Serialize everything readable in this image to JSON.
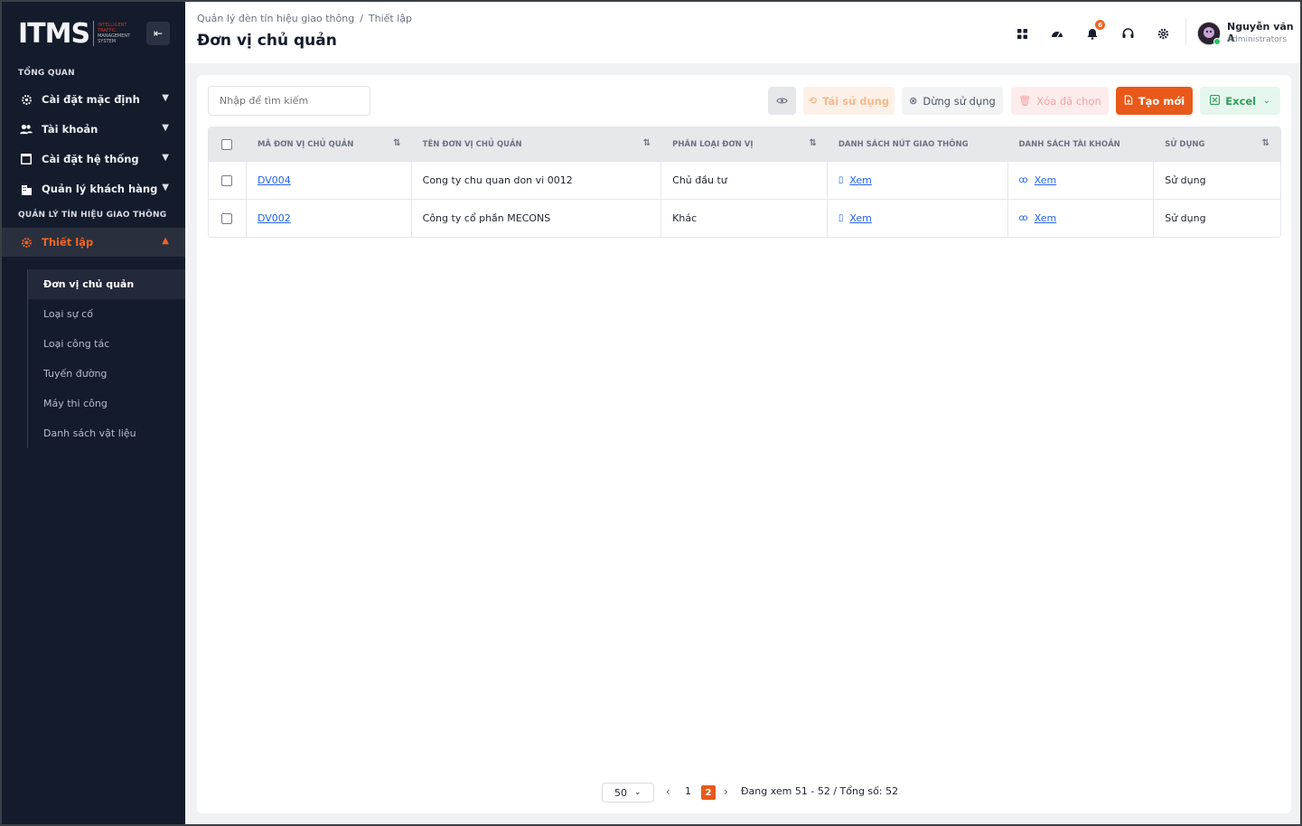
{
  "app": {
    "logo_text": "ITMS",
    "logo_sub": [
      "INTELLIGENT",
      "TRAFFIC",
      "MANAGEMENT",
      "SYSTEM"
    ]
  },
  "sidebar": {
    "section_overview": "TỔNG QUAN",
    "items": [
      {
        "label": "Cài đặt mặc định",
        "icon": "gear-icon"
      },
      {
        "label": "Tài khoản",
        "icon": "users-icon"
      },
      {
        "label": "Cài đặt hệ thống",
        "icon": "window-icon"
      },
      {
        "label": "Quản lý khách hàng",
        "icon": "building-icon"
      }
    ],
    "section_traffic": "QUẢN LÝ TÍN HIỆU GIAO THÔNG",
    "active_item": {
      "label": "Thiết lập",
      "icon": "gear-icon"
    },
    "subitems": [
      {
        "label": "Đơn vị chủ quản",
        "active": true
      },
      {
        "label": "Loại sự cố",
        "active": false
      },
      {
        "label": "Loại công tác",
        "active": false
      },
      {
        "label": "Tuyến đường",
        "active": false
      },
      {
        "label": "Máy thi công",
        "active": false
      },
      {
        "label": "Danh sách vật liệu",
        "active": false
      }
    ]
  },
  "header": {
    "breadcrumb": [
      "Quản lý đèn tín hiệu giao thông",
      "Thiết lập"
    ],
    "breadcrumb_sep": "/",
    "title": "Đơn vị chủ quản",
    "notification_count": "6",
    "user": {
      "name": "Nguyễn văn A",
      "role": "Administrators"
    }
  },
  "toolbar": {
    "search_placeholder": "Nhập để tìm kiếm",
    "reuse_label": "Tái sử dụng",
    "stop_label": "Dừng sử dụng",
    "delete_label": "Xóa đã chọn",
    "create_label": "Tạo mới",
    "excel_label": "Excel"
  },
  "table": {
    "columns": [
      "MÃ ĐƠN VỊ CHỦ QUẢN",
      "TÊN ĐƠN VỊ CHỦ QUẢN",
      "PHÂN LOẠI ĐƠN VỊ",
      "DANH SÁCH NÚT GIAO THÔNG",
      "DANH SÁCH TÀI KHOẢN",
      "SỬ DỤNG"
    ],
    "rows": [
      {
        "code": "DV004",
        "name": "Cong ty chu quan don vi 0012",
        "type": "Chủ đầu tư",
        "nodes": "Xem",
        "accounts": "Xem",
        "status": "Sử dụng"
      },
      {
        "code": "DV002",
        "name": "Công ty cổ phần MECONS",
        "type": "Khác",
        "nodes": "Xem",
        "accounts": "Xem",
        "status": "Sử dụng"
      }
    ]
  },
  "pagination": {
    "page_size": "50",
    "pages": [
      "1",
      "2"
    ],
    "current": "2",
    "info": "Đang xem 51 - 52 / Tổng số: 52"
  },
  "colors": {
    "accent": "#e8591a",
    "sidebar_bg": "#141b2b",
    "link": "#2563eb",
    "excel": "#2f9e5a"
  }
}
